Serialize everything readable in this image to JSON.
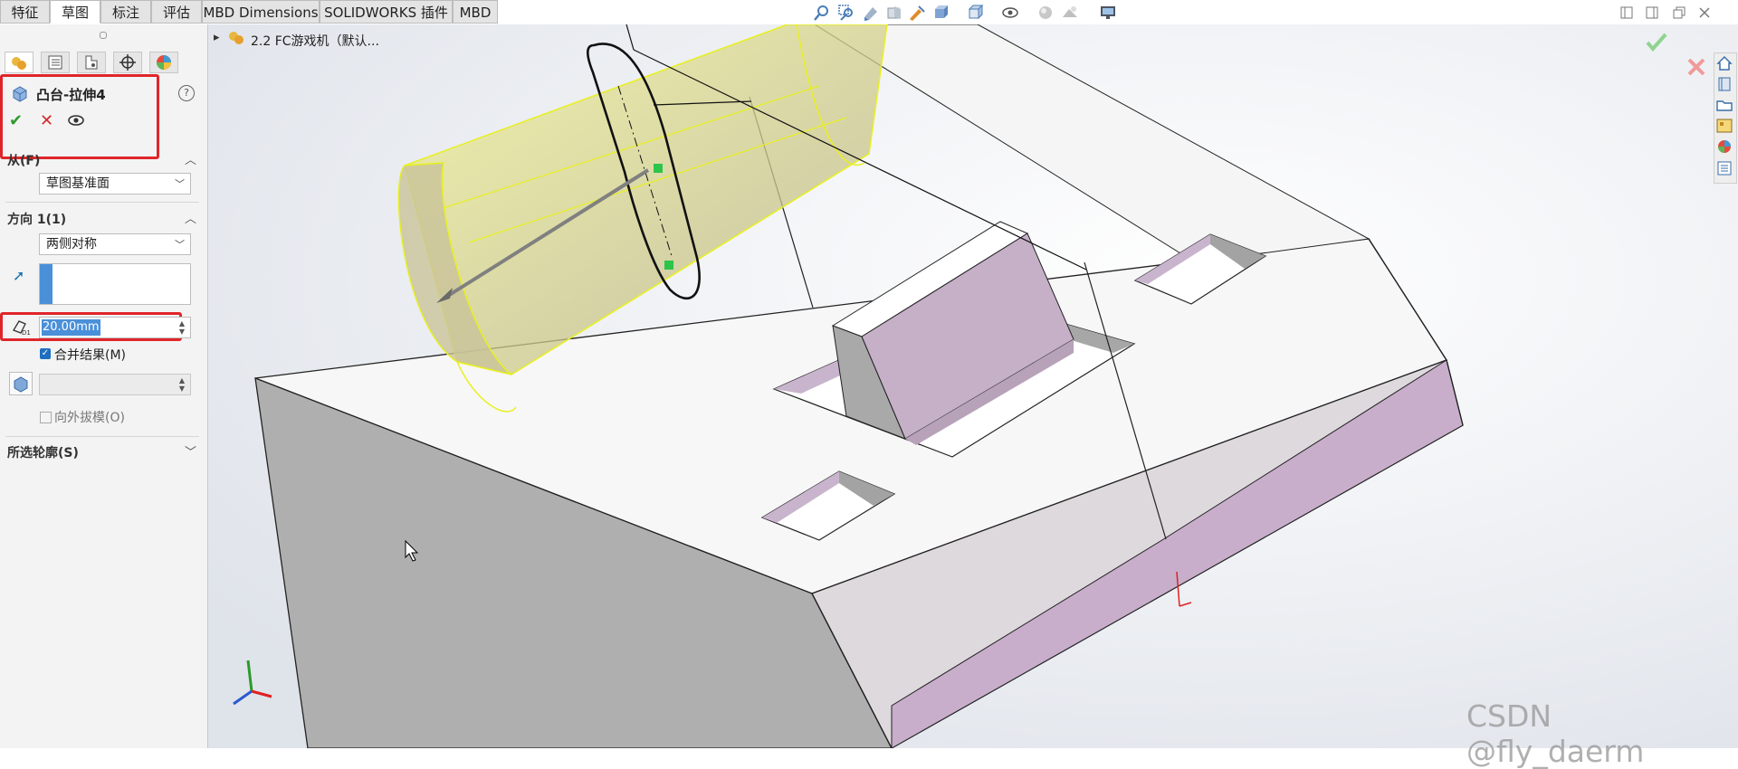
{
  "tabs": [
    {
      "label": "特征"
    },
    {
      "label": "草图"
    },
    {
      "label": "标注"
    },
    {
      "label": "评估"
    },
    {
      "label": "MBD Dimensions"
    },
    {
      "label": "SOLIDWORKS 插件"
    },
    {
      "label": "MBD"
    }
  ],
  "active_tab": "草图",
  "tree": {
    "item_label": "2.2 FC游戏机（默认..."
  },
  "pm": {
    "feature_title": "凸台-拉伸4",
    "from": {
      "label": "从(F)",
      "value": "草图基准面"
    },
    "direction1": {
      "label": "方向 1(1)",
      "end_condition": "两侧对称",
      "depth": "20.00mm"
    },
    "merge_result": {
      "label": "合并结果(M)",
      "checked": true
    },
    "draft_outward": {
      "label": "向外拔模(O)",
      "checked": false
    },
    "selected_contours": {
      "label": "所选轮廓(S)"
    }
  },
  "watermark": "CSDN @fly_daerm",
  "colors": {
    "accent_red": "#e0252a",
    "highlight_blue": "#4a90d9",
    "sketch_yellow": "#e8f020",
    "face_pink": "#c8aecb"
  }
}
